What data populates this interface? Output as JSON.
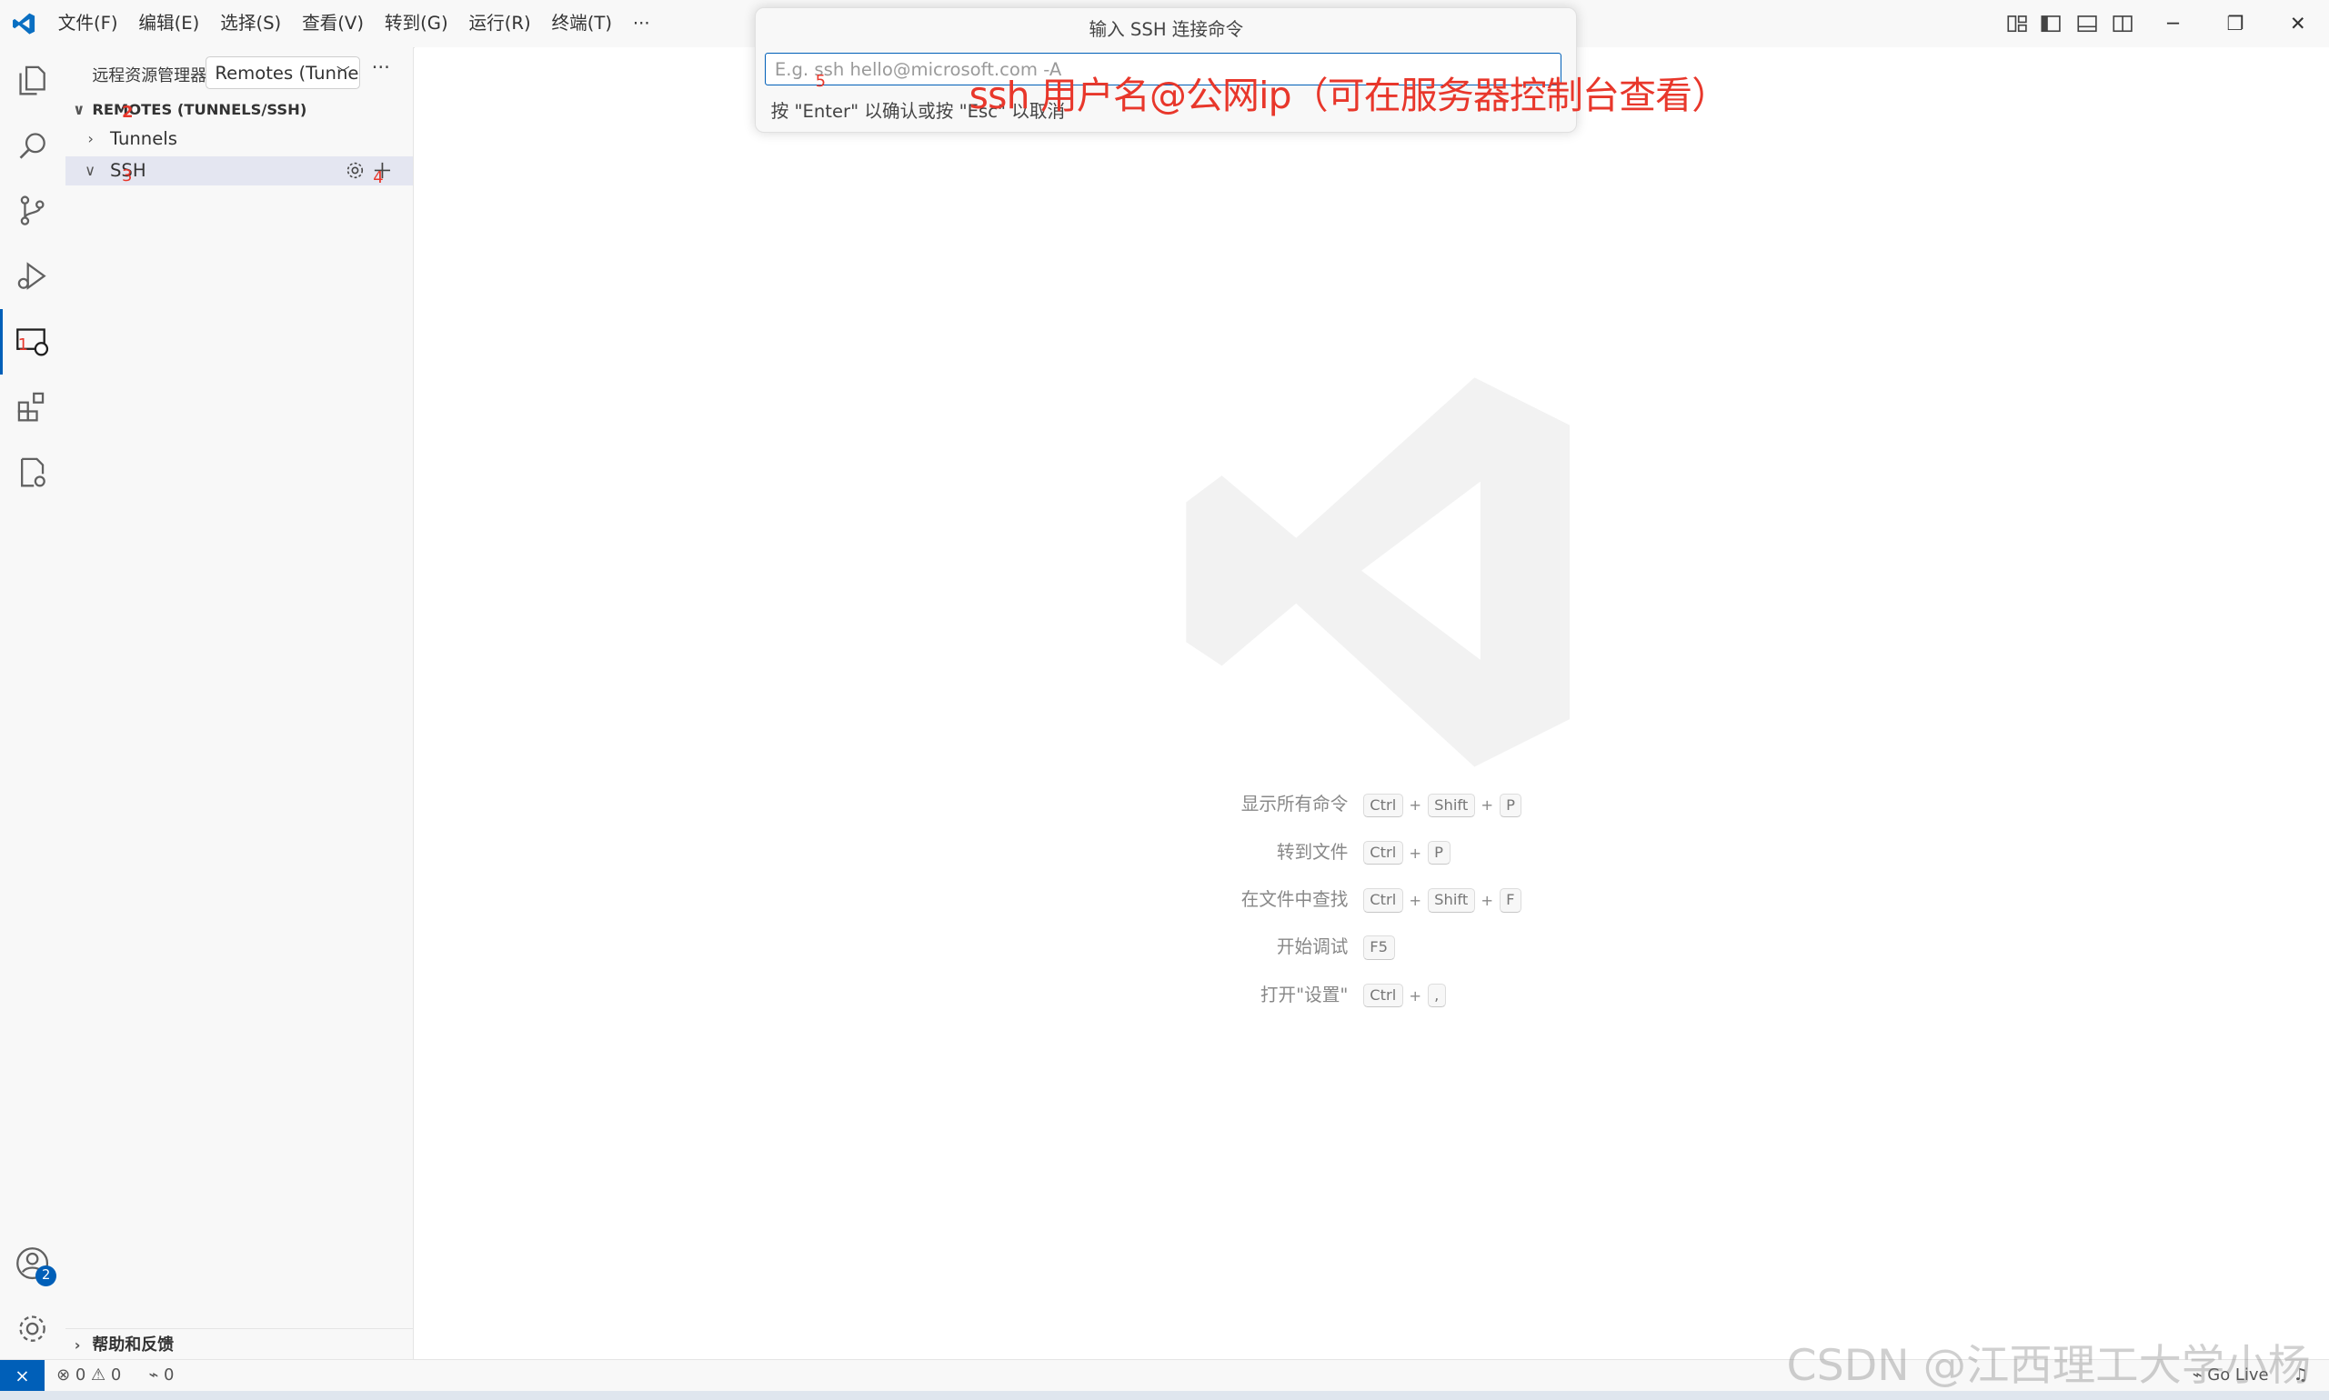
{
  "titlebar": {
    "menu": [
      "文件(F)",
      "编辑(E)",
      "选择(S)",
      "查看(V)",
      "转到(G)",
      "运行(R)",
      "终端(T)",
      "···"
    ]
  },
  "quick_input": {
    "title": "输入 SSH 连接命令",
    "placeholder": "E.g. ssh hello@microsoft.com -A",
    "message": "按 \"Enter\" 以确认或按 \"Esc\" 以取消"
  },
  "sidebar": {
    "title": "远程资源管理器",
    "select_value": "Remotes (Tunnels/SSH)",
    "more": "···",
    "section_header": "REMOTES (TUNNELS/SSH)",
    "items": [
      {
        "label": "Tunnels"
      },
      {
        "label": "SSH"
      }
    ],
    "help_section": "帮助和反馈"
  },
  "activity_bar": {
    "accounts_badge": "2"
  },
  "editor": {
    "shortcuts": [
      {
        "label": "显示所有命令",
        "keys": [
          "Ctrl",
          "Shift",
          "P"
        ]
      },
      {
        "label": "转到文件",
        "keys": [
          "Ctrl",
          "P"
        ]
      },
      {
        "label": "在文件中查找",
        "keys": [
          "Ctrl",
          "Shift",
          "F"
        ]
      },
      {
        "label": "开始调试",
        "keys": [
          "F5"
        ]
      },
      {
        "label": "打开\"设置\"",
        "keys": [
          "Ctrl",
          ","
        ]
      }
    ]
  },
  "statusbar": {
    "errors": "0",
    "warnings": "0",
    "ports": "0",
    "go_live": "Go Live"
  },
  "annotations": {
    "main": "ssh 用户名@公网ip（可在服务器控制台查看）",
    "n1": "1",
    "n2": "2",
    "n3": "3",
    "n4": "4",
    "n5": "5"
  },
  "watermark": "CSDN @江西理工大学小杨",
  "colors": {
    "accent": "#005fb8",
    "annotation": "#e8372b"
  }
}
